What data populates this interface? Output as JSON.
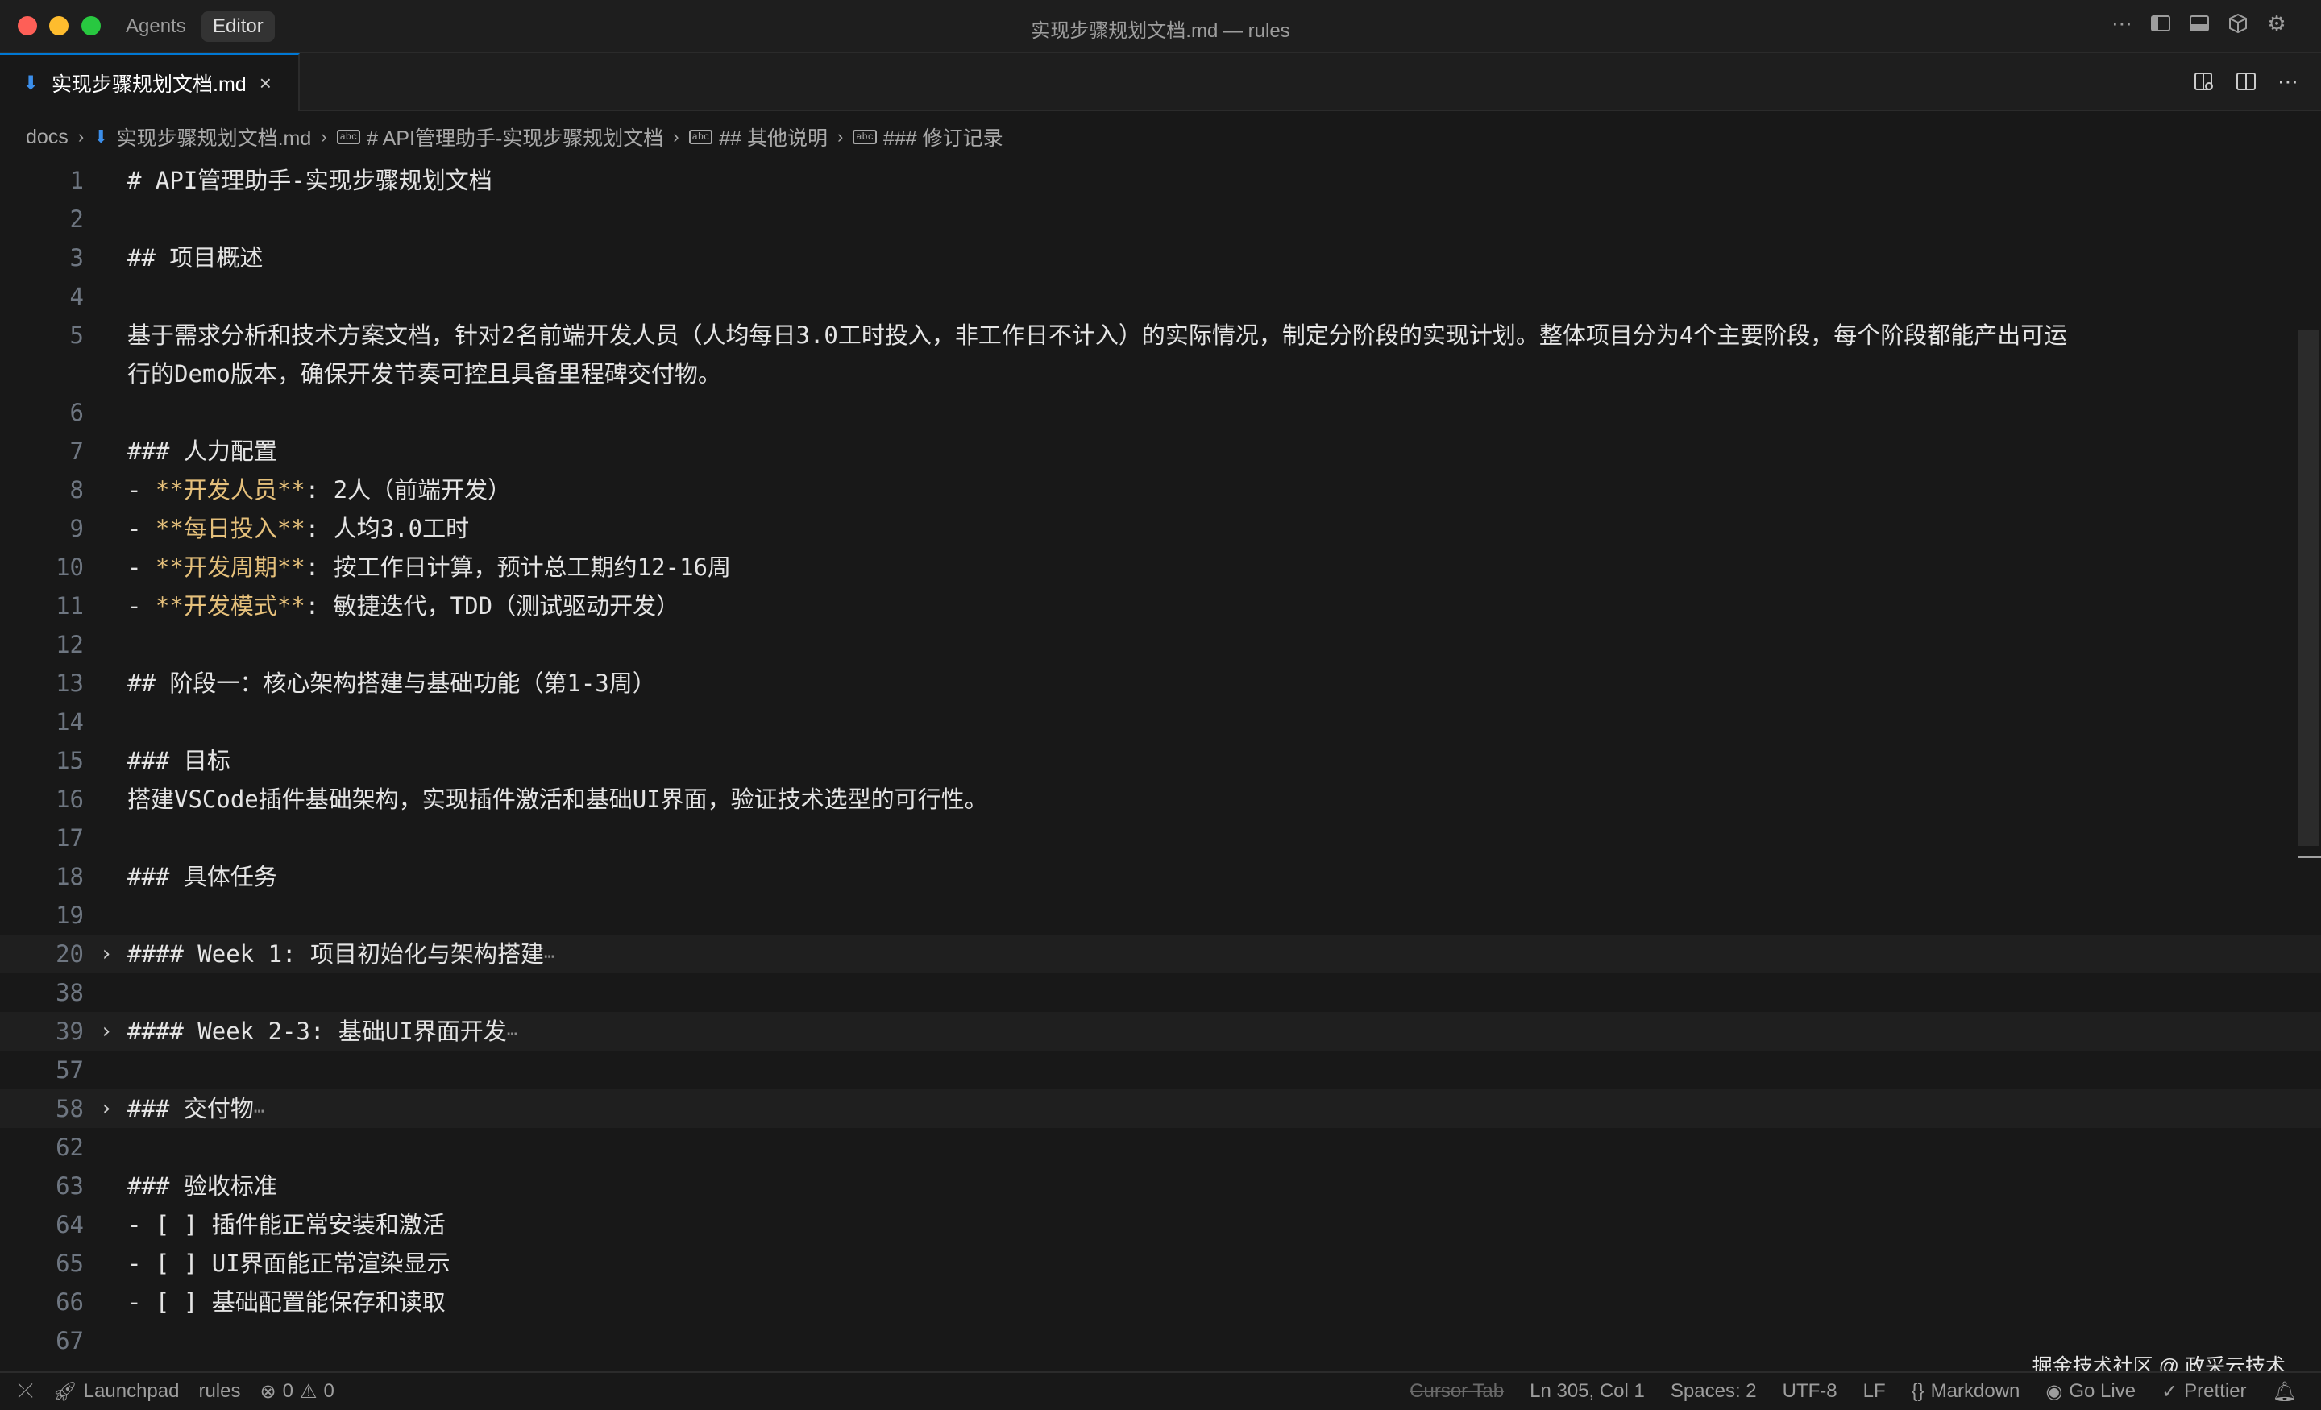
{
  "titlebar": {
    "modes": [
      "Agents",
      "Editor"
    ],
    "title": "实现步骤规划文档.md — rules",
    "icons": [
      "more-icon",
      "toggle-sidebar-icon",
      "toggle-panel-icon",
      "extensions-cube-icon",
      "settings-gear-icon"
    ]
  },
  "tab": {
    "label": "实现步骤规划文档.md",
    "close": "×"
  },
  "breadcrumb": {
    "items": [
      "docs",
      "实现步骤规划文档.md",
      "# API管理助手-实现步骤规划文档",
      "## 其他说明",
      "### 修订记录"
    ]
  },
  "editor": {
    "lines": [
      {
        "n": "1",
        "text": "# API管理助手-实现步骤规划文档"
      },
      {
        "n": "2",
        "text": ""
      },
      {
        "n": "3",
        "text": "## 项目概述"
      },
      {
        "n": "4",
        "text": ""
      },
      {
        "n": "5",
        "text": "基于需求分析和技术方案文档，针对2名前端开发人员（人均每日3.0工时投入，非工作日不计入）的实际情况，制定分阶段的实现计划。整体项目分为4个主要阶段，每个阶段都能产出可运"
      },
      {
        "n": "",
        "text": "行的Demo版本，确保开发节奏可控且具备里程碑交付物。"
      },
      {
        "n": "6",
        "text": ""
      },
      {
        "n": "7",
        "text": "### 人力配置"
      },
      {
        "n": "8",
        "prefix": "- ",
        "bold": "**开发人员**",
        "text": ": 2人（前端开发）"
      },
      {
        "n": "9",
        "prefix": "- ",
        "bold": "**每日投入**",
        "text": ": 人均3.0工时"
      },
      {
        "n": "10",
        "prefix": "- ",
        "bold": "**开发周期**",
        "text": ": 按工作日计算，预计总工期约12-16周"
      },
      {
        "n": "11",
        "prefix": "- ",
        "bold": "**开发模式**",
        "text": ": 敏捷迭代，TDD（测试驱动开发）"
      },
      {
        "n": "12",
        "text": ""
      },
      {
        "n": "13",
        "text": "## 阶段一：核心架构搭建与基础功能（第1-3周）"
      },
      {
        "n": "14",
        "text": ""
      },
      {
        "n": "15",
        "text": "### 目标"
      },
      {
        "n": "16",
        "text": "搭建VSCode插件基础架构，实现插件激活和基础UI界面，验证技术选型的可行性。"
      },
      {
        "n": "17",
        "text": ""
      },
      {
        "n": "18",
        "text": "### 具体任务"
      },
      {
        "n": "19",
        "text": ""
      },
      {
        "n": "20",
        "text": "#### Week 1: 项目初始化与架构搭建",
        "folded": true
      },
      {
        "n": "38",
        "text": ""
      },
      {
        "n": "39",
        "text": "#### Week 2-3: 基础UI界面开发",
        "folded": true
      },
      {
        "n": "57",
        "text": ""
      },
      {
        "n": "58",
        "text": "### 交付物",
        "folded": true
      },
      {
        "n": "62",
        "text": ""
      },
      {
        "n": "63",
        "text": "### 验收标准"
      },
      {
        "n": "64",
        "text": "- [ ] 插件能正常安装和激活"
      },
      {
        "n": "65",
        "text": "- [ ] UI界面能正常渲染显示"
      },
      {
        "n": "66",
        "text": "- [ ] 基础配置能保存和读取"
      },
      {
        "n": "67",
        "text": ""
      }
    ],
    "fold_ellipsis": "⋯"
  },
  "watermark": "掘金技术社区 @ 政采云技术",
  "statusbar": {
    "launchpad": "Launchpad",
    "branch": "rules",
    "errors": "0",
    "warnings": "0",
    "cursor_tab": "Cursor Tab",
    "position": "Ln 305, Col 1",
    "spaces": "Spaces: 2",
    "encoding": "UTF-8",
    "eol": "LF",
    "language": "Markdown",
    "golive": "Go Live",
    "prettier": "Prettier"
  },
  "colors": {
    "background": "#181818",
    "bold_markdown": "#e5c07b",
    "accent": "#0078d4"
  }
}
